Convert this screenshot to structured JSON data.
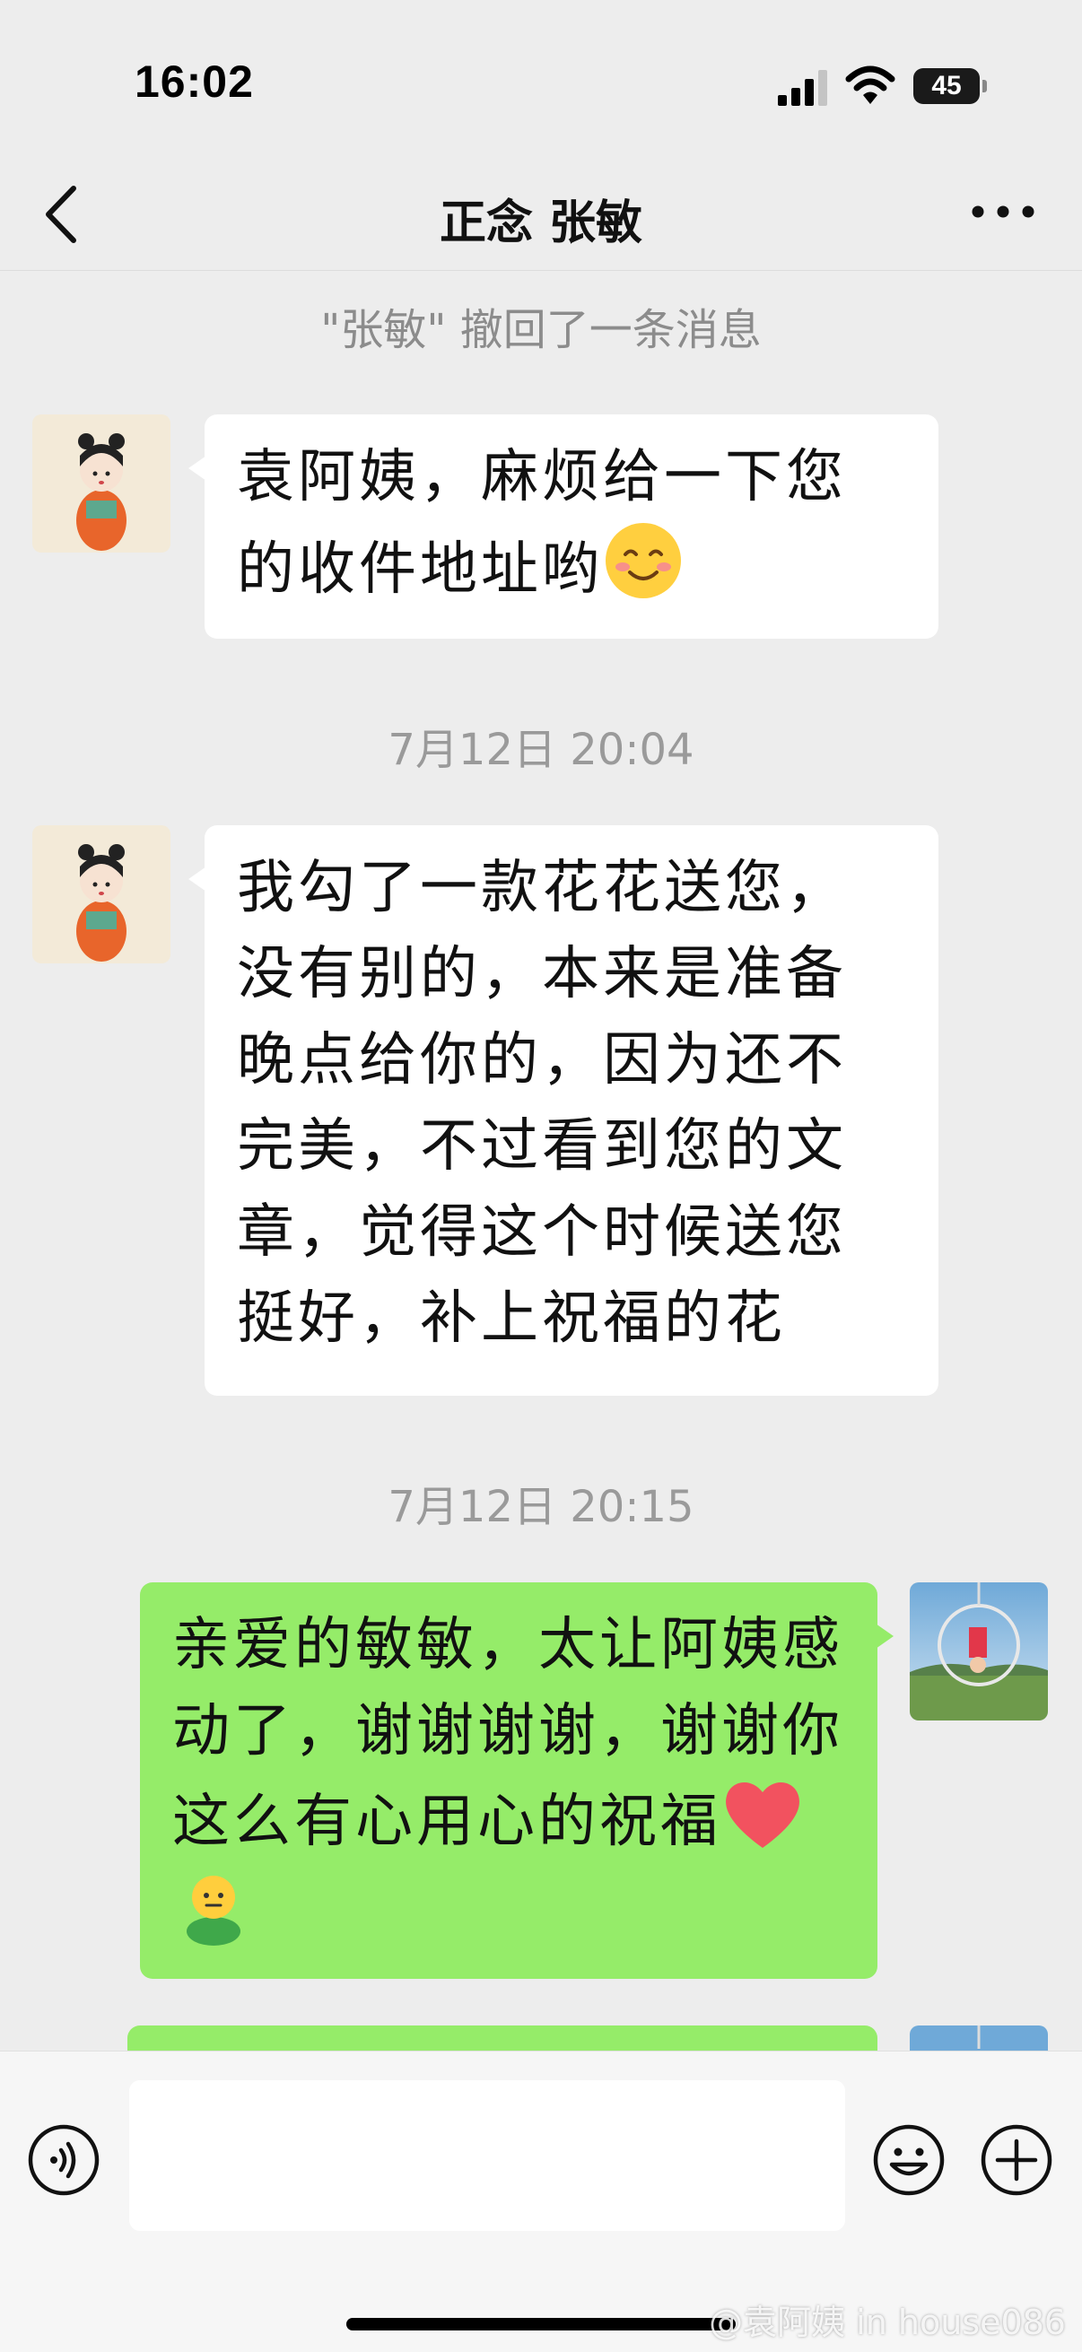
{
  "status_bar": {
    "time": "16:02",
    "battery": "45"
  },
  "nav": {
    "title": "正念 张敏"
  },
  "chat": {
    "system_note": "\"张敏\" 撤回了一条消息",
    "messages": [
      {
        "direction": "in",
        "text": "袁阿姨，麻烦给一下您的收件地址哟",
        "emoji": "smiling-face-emoji"
      },
      {
        "direction": "in",
        "text": "我勾了一款花花送您，没有别的，本来是准备晚点给你的，因为还不完美，不过看到您的文章，觉得这个时候送您挺好，补上祝福的花"
      },
      {
        "direction": "out",
        "text": "亲爱的敏敏，太让阿姨感动了，谢谢谢谢，谢谢你这么有心用心的祝福",
        "emojis": [
          "red-heart-emoji",
          "person-emoji"
        ]
      }
    ],
    "timestamps": [
      "7月12日 20:04",
      "7月12日 20:15"
    ]
  },
  "input_bar": {
    "placeholder": ""
  },
  "watermark": "@袁阿姨 in house086",
  "colors": {
    "background": "#ededed",
    "outgoing_bubble": "#95ec69",
    "incoming_bubble": "#ffffff"
  }
}
